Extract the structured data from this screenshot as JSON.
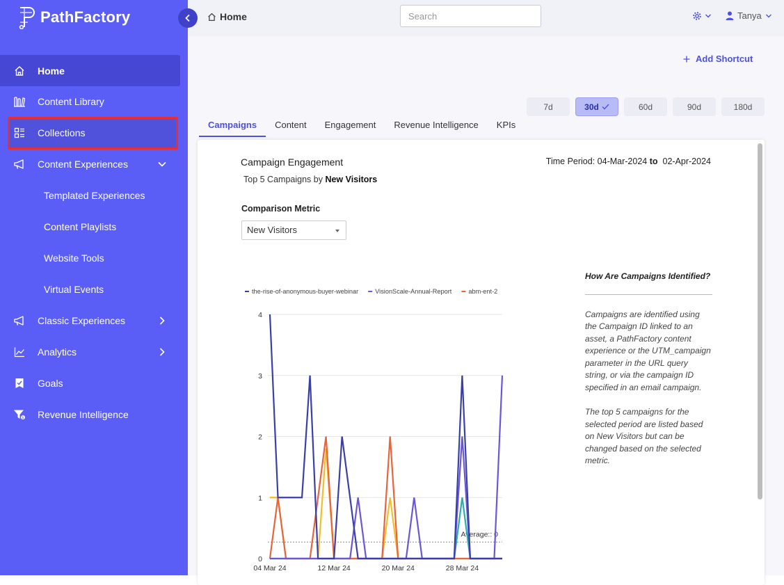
{
  "sidebar": {
    "brand": "PathFactory",
    "items": [
      {
        "label": "Home",
        "icon": "home-icon"
      },
      {
        "label": "Content Library",
        "icon": "library-icon"
      },
      {
        "label": "Collections",
        "icon": "collections-icon"
      },
      {
        "label": "Content Experiences",
        "icon": "megaphone-icon"
      },
      {
        "label": "Templated Experiences"
      },
      {
        "label": "Content Playlists"
      },
      {
        "label": "Website Tools"
      },
      {
        "label": "Virtual Events"
      },
      {
        "label": "Classic Experiences",
        "icon": "megaphone-icon"
      },
      {
        "label": "Analytics",
        "icon": "analytics-icon"
      },
      {
        "label": "Goals",
        "icon": "goals-icon"
      },
      {
        "label": "Revenue Intelligence",
        "icon": "revenue-icon"
      }
    ]
  },
  "topbar": {
    "breadcrumb": "Home",
    "search_placeholder": "Search",
    "user": "Tanya"
  },
  "main": {
    "shortcut_label": "Add Shortcut",
    "periods": [
      "7d",
      "30d",
      "60d",
      "90d",
      "180d"
    ],
    "active_period": "30d",
    "tabs": [
      "Campaigns",
      "Content",
      "Engagement",
      "Revenue Intelligence",
      "KPIs"
    ],
    "active_tab": "Campaigns"
  },
  "card": {
    "title": "Campaign Engagement",
    "subtitle_prefix": "Top 5 Campaigns by",
    "subtitle_metric": "New Visitors",
    "period_label": "Time Period:",
    "period_start": "04-Mar-2024",
    "period_to": "to",
    "period_end": "02-Apr-2024",
    "comparison_label": "Comparison Metric",
    "comparison_value": "New Visitors",
    "info_heading": "How Are Campaigns Identified?",
    "info_p1": "Campaigns are identified using the Campaign ID linked to an asset, a PathFactory content experience or the UTM_campaign parameter in the URL query string, or via the campaign ID specified in an email campaign.",
    "info_p2": "The top 5 campaigns for the selected period are listed based on New Visitors but can be changed based on the selected metric."
  },
  "colors": {
    "sidebar": "#5b5ef6",
    "accent": "#4d50e0",
    "highlight": "#e2303a"
  },
  "chart_data": {
    "type": "line",
    "x": [
      "04 Mar 24",
      "05 Mar 24",
      "06 Mar 24",
      "07 Mar 24",
      "08 Mar 24",
      "09 Mar 24",
      "10 Mar 24",
      "11 Mar 24",
      "12 Mar 24",
      "13 Mar 24",
      "14 Mar 24",
      "15 Mar 24",
      "16 Mar 24",
      "17 Mar 24",
      "18 Mar 24",
      "19 Mar 24",
      "20 Mar 24",
      "21 Mar 24",
      "22 Mar 24",
      "23 Mar 24",
      "24 Mar 24",
      "25 Mar 24",
      "26 Mar 24",
      "27 Mar 24",
      "28 Mar 24",
      "29 Mar 24",
      "30 Mar 24",
      "31 Mar 24",
      "01 Apr 24",
      "02 Apr 24"
    ],
    "xticks": [
      "04 Mar 24",
      "12 Mar 24",
      "20 Mar 24",
      "28 Mar 24"
    ],
    "ylim": [
      0,
      4
    ],
    "yticks": [
      0,
      1,
      2,
      3,
      4
    ],
    "series": [
      {
        "name": "the-rise-of-anonymous-buyer-webinar",
        "color": "#3a3fa8",
        "values": [
          4,
          1,
          1,
          1,
          1,
          3,
          0,
          0,
          0,
          2,
          1,
          0,
          0,
          0,
          0,
          0,
          0,
          0,
          0,
          0,
          0,
          0,
          0,
          0,
          3,
          0,
          0,
          0,
          0,
          0
        ]
      },
      {
        "name": "VisionScale-Annual-Report",
        "color": "#6b56d6",
        "values": [
          0,
          0,
          0,
          0,
          0,
          0,
          0,
          0,
          0,
          0,
          0,
          1,
          0,
          0,
          0,
          0,
          0,
          0,
          1,
          0,
          0,
          0,
          0,
          0,
          2,
          0,
          0,
          0,
          0,
          3
        ]
      },
      {
        "name": "abm-ent-2",
        "color": "#e8643a",
        "values": [
          0,
          1,
          0,
          0,
          0,
          0,
          1,
          2,
          0,
          0,
          0,
          0,
          0,
          0,
          0,
          2,
          0,
          0,
          0,
          0,
          0,
          0,
          0,
          0,
          0,
          0,
          0,
          0,
          0,
          0
        ]
      },
      {
        "name": "",
        "color": "#2aaeaa",
        "values": [
          0,
          0,
          0,
          0,
          0,
          0,
          0,
          0,
          0,
          0,
          0,
          0,
          0,
          0,
          0,
          0,
          0,
          0,
          0,
          0,
          0,
          0,
          0,
          0,
          1,
          0,
          0,
          0,
          0,
          0
        ]
      },
      {
        "name": "",
        "color": "#f5bd2b",
        "values": [
          1,
          1,
          0,
          0,
          0,
          0,
          0,
          1.8,
          0,
          0,
          0,
          0,
          0,
          0,
          0,
          1,
          0,
          0,
          0,
          0,
          0,
          0,
          0,
          0,
          0,
          0,
          0,
          0,
          0,
          0
        ]
      }
    ],
    "average_label": "Average:: 0",
    "average_value": 0.27
  }
}
